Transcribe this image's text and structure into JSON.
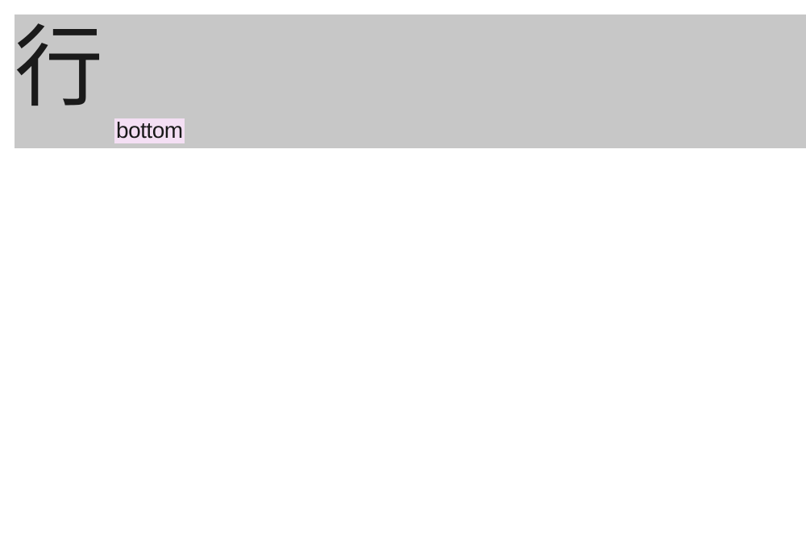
{
  "banner": {
    "glyph": "行",
    "tag": "bottom"
  }
}
